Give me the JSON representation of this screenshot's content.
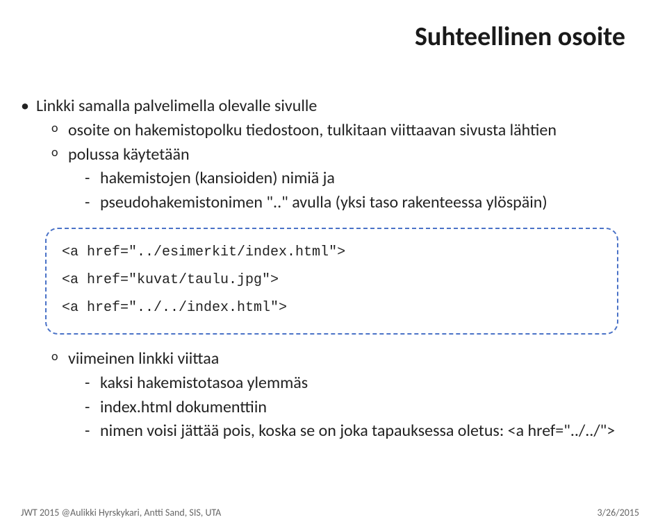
{
  "title": "Suhteellinen osoite",
  "bullets": {
    "l1_1": "Linkki samalla palvelimella olevalle sivulle",
    "l2_1": "osoite on hakemistopolku tiedostoon, tulkitaan viittaavan sivusta lähtien",
    "l2_2": "polussa käytetään",
    "l3_1": "hakemistojen (kansioiden) nimiä ja",
    "l3_2": "pseudohakemistonimen \"..\" avulla (yksi taso rakenteessa ylöspäin)",
    "l2_3": "viimeinen linkki viittaa",
    "l3_3": "kaksi hakemistotasoa ylemmäs",
    "l3_4": "index.html dokumenttiin",
    "l3_5": "nimen voisi jättää pois, koska se on joka tapauksessa oletus: <a href=\"../../\">"
  },
  "code": {
    "line1": "<a href=\"../esimerkit/index.html\">",
    "line2": "<a href=\"kuvat/taulu.jpg\">",
    "line3": "<a href=\"../../index.html\">"
  },
  "footer": {
    "left": "JWT 2015 @Aulikki Hyrskykari, Antti Sand, SIS, UTA",
    "right": "3/26/2015"
  }
}
